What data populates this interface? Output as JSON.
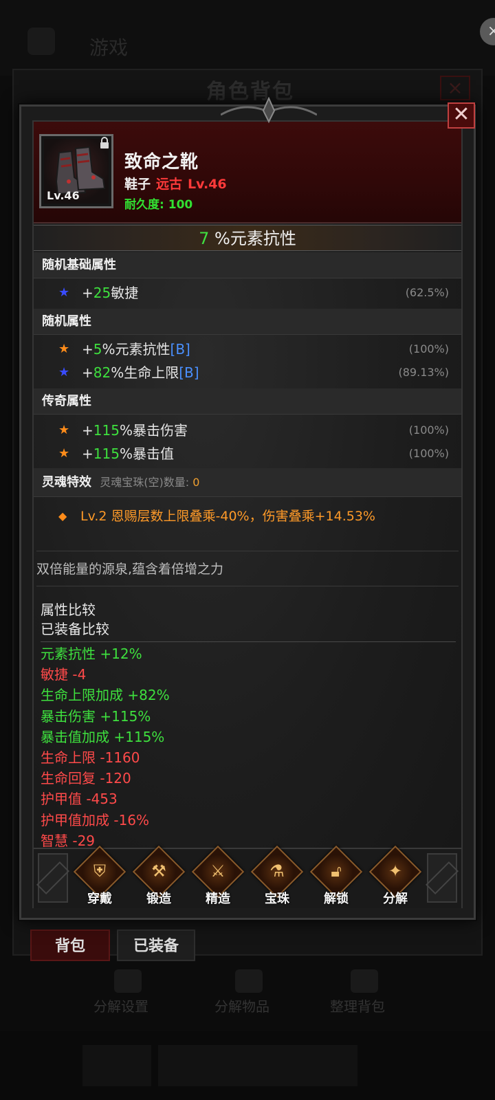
{
  "background": {
    "top_tab": "游戏",
    "panel_title": "角色背包",
    "close_circle": "×",
    "tabs": [
      {
        "label": "背包"
      },
      {
        "label": "已装备"
      }
    ],
    "actions": [
      {
        "label": "分解设置"
      },
      {
        "label": "分解物品"
      },
      {
        "label": "整理背包"
      }
    ]
  },
  "modal": {
    "close": "✕",
    "item": {
      "level_badge": "Lv.46",
      "name": "致命之靴",
      "type": "鞋子",
      "quality": "远古",
      "level": "Lv.46",
      "durability_label": "耐久度:",
      "durability_value": "100",
      "icon": "boots-icon",
      "lock_icon": "lock-icon"
    },
    "main_stat": {
      "value": "7",
      "label": "%元素抗性"
    },
    "sections": {
      "base_title": "随机基础属性",
      "base": [
        {
          "star": "blue",
          "prefix": "+",
          "value": "25",
          "name": "敏捷",
          "tag": "",
          "pct": "(62.5%)"
        }
      ],
      "random_title": "随机属性",
      "random": [
        {
          "star": "orange",
          "prefix": "+",
          "value": "5",
          "name": "%元素抗性",
          "tag": "[B]",
          "pct": "(100%)"
        },
        {
          "star": "blue",
          "prefix": "+",
          "value": "82",
          "name": "%生命上限",
          "tag": "[B]",
          "pct": "(89.13%)"
        }
      ],
      "legend_title": "传奇属性",
      "legend": [
        {
          "star": "orange",
          "prefix": "+",
          "value": "115",
          "name": "%暴击伤害",
          "pct": "(100%)"
        },
        {
          "star": "orange",
          "prefix": "+",
          "value": "115",
          "name": "%暴击值",
          "pct": "(100%)"
        }
      ],
      "soul_title": "灵魂特效",
      "soul_sub_label": "灵魂宝珠(空)数量:",
      "soul_sub_count": "0",
      "soul_effect": "Lv.2 恩赐层数上限叠乘-40%，伤害叠乘+14.53%"
    },
    "flavor": "双倍能量的源泉,蕴含着倍增之力",
    "compare": {
      "title": "属性比较",
      "subtitle": "已装备比较",
      "lines": [
        {
          "text": "元素抗性 +12%",
          "dir": "up"
        },
        {
          "text": "敏捷 -4",
          "dir": "down"
        },
        {
          "text": "生命上限加成 +82%",
          "dir": "up"
        },
        {
          "text": "暴击伤害 +115%",
          "dir": "up"
        },
        {
          "text": "暴击值加成 +115%",
          "dir": "up"
        },
        {
          "text": "生命上限 -1160",
          "dir": "down"
        },
        {
          "text": "生命回复 -120",
          "dir": "down"
        },
        {
          "text": "护甲值 -453",
          "dir": "down"
        },
        {
          "text": "护甲值加成 -16%",
          "dir": "down"
        },
        {
          "text": "智慧 -29",
          "dir": "down"
        }
      ]
    },
    "actions": [
      {
        "label": "穿戴",
        "icon": "armor-icon"
      },
      {
        "label": "锻造",
        "icon": "anvil-icon"
      },
      {
        "label": "精造",
        "icon": "hammer-icon"
      },
      {
        "label": "宝珠",
        "icon": "potion-icon"
      },
      {
        "label": "解锁",
        "icon": "unlock-icon"
      },
      {
        "label": "分解",
        "icon": "break-icon"
      }
    ]
  },
  "colors": {
    "green": "#3ee03e",
    "red": "#ff4a4a",
    "orange": "#ff9a28",
    "blue_tag": "#4a90ff",
    "header_red": "#3c0b0b"
  }
}
